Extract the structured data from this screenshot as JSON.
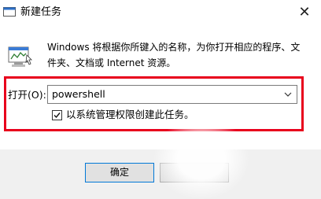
{
  "window": {
    "title": "新建任务",
    "close_glyph": "✕"
  },
  "icons": {
    "app": "run-dialog-icon",
    "close": "close-icon",
    "big": "run-program-icon",
    "dropdown": "chevron-down-icon",
    "check": "checkmark-icon"
  },
  "description": "Windows 将根据你所键入的名称，为你打开相应的程序、文件夹、文档或 Internet 资源。",
  "open": {
    "label": "打开(O):",
    "value": "powershell"
  },
  "admin_checkbox": {
    "label": "以系统管理权限创建此任务。",
    "checked": true
  },
  "buttons": {
    "ok": "确定"
  },
  "colors": {
    "highlight": "#e8001c",
    "accent": "#0078d7"
  }
}
